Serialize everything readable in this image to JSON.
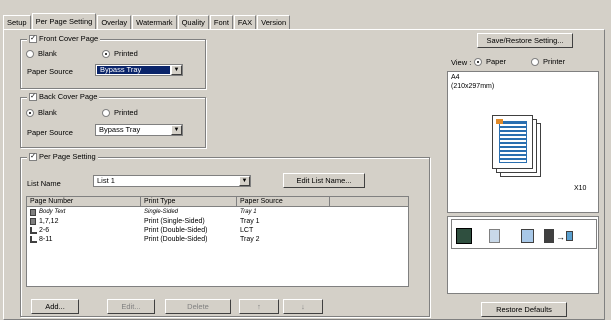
{
  "tabs": [
    "Setup",
    "Per Page Setting",
    "Overlay",
    "Watermark",
    "Quality",
    "Font",
    "FAX",
    "Version"
  ],
  "front": {
    "legend": "Front Cover Page",
    "blank": "Blank",
    "printed": "Printed",
    "source_label": "Paper Source",
    "source_value": "Bypass Tray"
  },
  "back": {
    "legend": "Back Cover Page",
    "blank": "Blank",
    "printed": "Printed",
    "source_label": "Paper Source",
    "source_value": "Bypass Tray"
  },
  "per_page": {
    "legend": "Per Page Setting",
    "list_label": "List Name",
    "list_value": "List 1",
    "edit_button": "Edit List Name...",
    "columns": [
      "Page Number",
      "Print Type",
      "Paper Source"
    ],
    "rows": [
      {
        "page": "Body Text",
        "type": "Single-Sided",
        "source": "Tray 1"
      },
      {
        "page": "1,7,12",
        "type": "Print (Single-Sided)",
        "source": "Tray 1"
      },
      {
        "page": "2-6",
        "type": "Print (Double-Sided)",
        "source": "LCT"
      },
      {
        "page": "8-11",
        "type": "Print (Double-Sided)",
        "source": "Tray 2"
      }
    ],
    "add": "Add...",
    "edit": "Edit...",
    "delete": "Delete",
    "up": "↑",
    "down": "↓"
  },
  "right": {
    "save_button": "Save/Restore Setting...",
    "view_label": "View :",
    "paper": "Paper",
    "printer": "Printer",
    "paper_size": "A4",
    "paper_dims": "(210x297mm)",
    "count": "X10",
    "restore_button": "Restore Defaults"
  }
}
